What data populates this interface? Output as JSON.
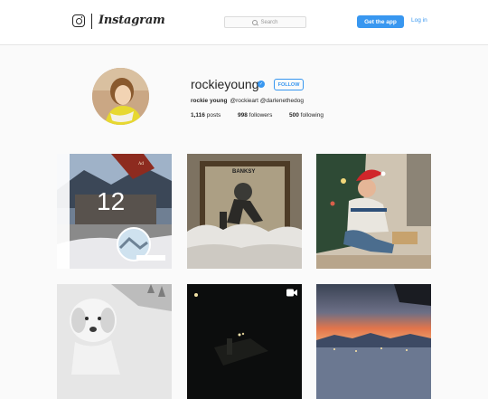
{
  "nav": {
    "brand": "Instagram",
    "search_placeholder": "Search",
    "get_app_label": "Get the app",
    "login_label": "Log in"
  },
  "profile": {
    "username": "rockieyoung",
    "verified": true,
    "follow_label": "FOLLOW",
    "full_name": "rockie young",
    "bio_mentions": "@rockieart @darlenethedog",
    "posts_count": "1,116",
    "posts_label": "posts",
    "followers_count": "998",
    "followers_label": "followers",
    "following_count": "500",
    "following_label": "following"
  },
  "grid": {
    "posts": [
      {
        "overlay_text": "12"
      },
      {
        "sign_text": "BANKSY"
      },
      {},
      {},
      {
        "has_video_icon": true
      },
      {}
    ]
  },
  "colors": {
    "accent": "#3897f0",
    "text": "#262626",
    "background": "#fafafa"
  }
}
